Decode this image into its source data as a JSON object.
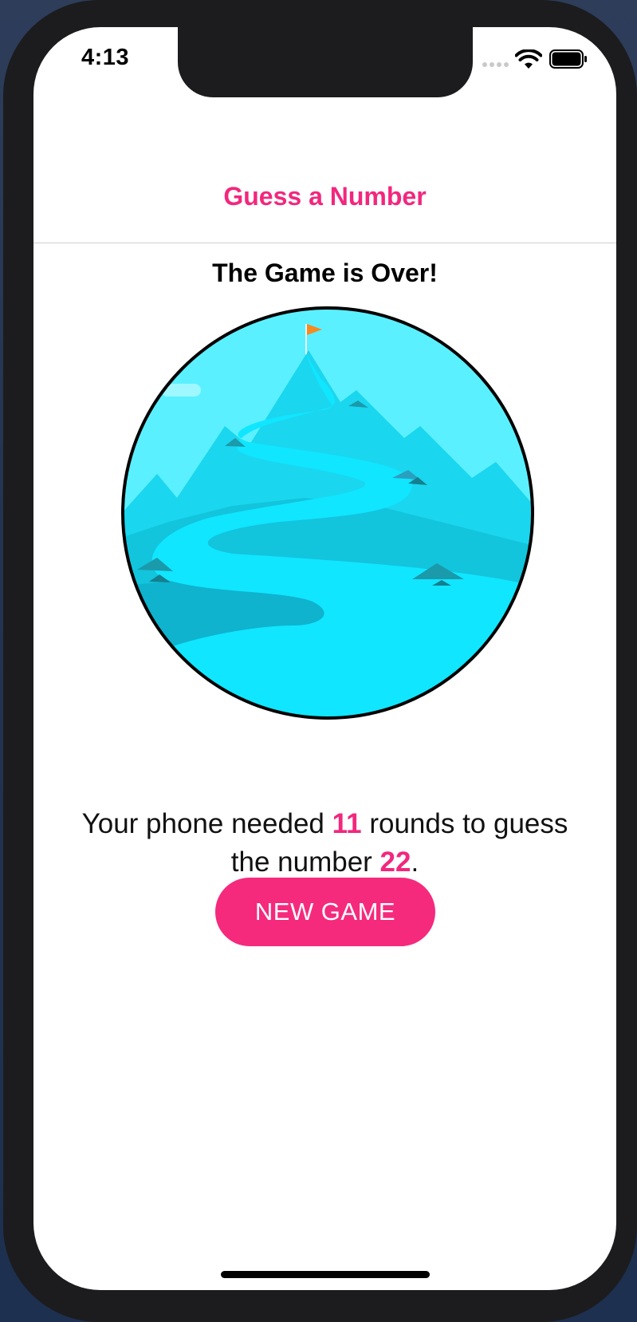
{
  "status_bar": {
    "time": "4:13",
    "icons": [
      "cellular-signal-icon",
      "wifi-icon",
      "battery-icon"
    ]
  },
  "header": {
    "title": "Guess a Number"
  },
  "main": {
    "heading": "The Game is Over!",
    "result": {
      "prefix": "Your phone needed ",
      "rounds": "11",
      "middle": " rounds to guess the number ",
      "number": "22",
      "suffix": "."
    },
    "new_game_label": "NEW GAME"
  },
  "colors": {
    "accent": "#f2277d",
    "button": "#f52a7d",
    "sky": "#5bf0ff",
    "mountain": "#17cbe3",
    "river": "#10e6ff"
  }
}
